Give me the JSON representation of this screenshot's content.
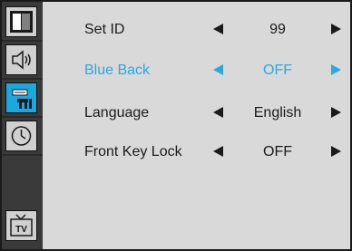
{
  "sidebar": {
    "items": [
      {
        "icon": "picture-icon",
        "active": false
      },
      {
        "icon": "sound-icon",
        "active": false
      },
      {
        "icon": "setup-tools-icon",
        "active": true
      },
      {
        "icon": "clock-icon",
        "active": false
      },
      {
        "icon": "tv-icon",
        "active": false,
        "label": "TV"
      }
    ]
  },
  "menu": {
    "items": [
      {
        "label": "Set ID",
        "value": "99",
        "selected": false
      },
      {
        "label": "Blue Back",
        "value": "OFF",
        "selected": true
      },
      {
        "label": "Language",
        "value": "English",
        "selected": false
      },
      {
        "label": "Front Key Lock",
        "value": "OFF",
        "selected": false
      }
    ]
  },
  "colors": {
    "highlight": "#2aa8e0",
    "sidebar_bg": "#3a3a3a",
    "panel_bg": "#d9d9d9"
  }
}
